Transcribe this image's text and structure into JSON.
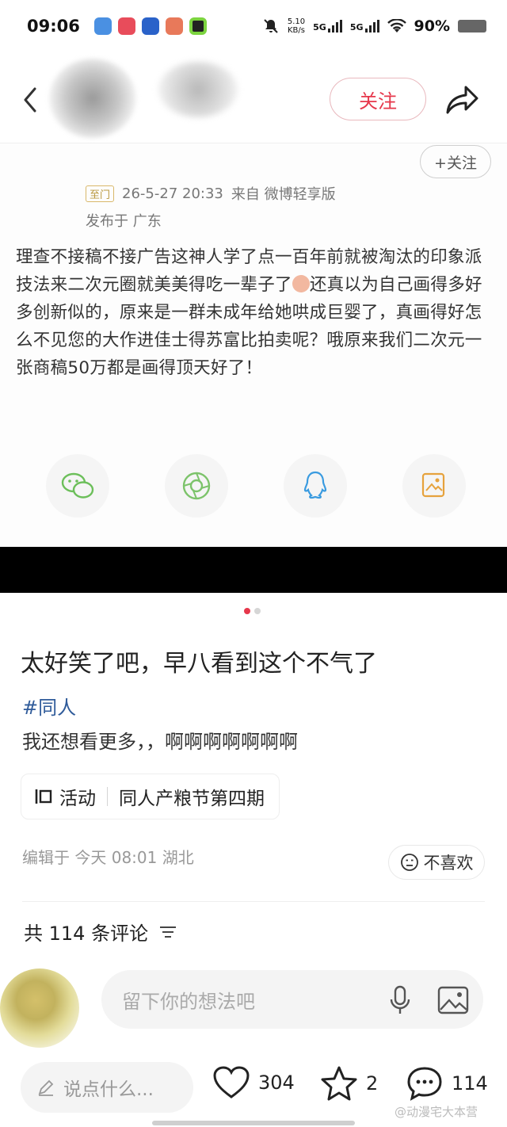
{
  "status_bar": {
    "time": "09:06",
    "speed_value": "5.10",
    "speed_unit": "KB/s",
    "network1": "5G",
    "network2": "5G",
    "battery": "90%",
    "app_icon_colors": [
      "#4a90e2",
      "#e84c5b",
      "#2a62c9",
      "#e8795a",
      "#222222"
    ]
  },
  "nav": {
    "follow_label": "关注"
  },
  "weibo_card": {
    "follow_small_label": "+关注",
    "vip_badge": "⾄门",
    "datetime": "26-5-27 20:33",
    "source": "来自 微博轻享版",
    "location": "发布于 广东",
    "text_part1": "理查不接稿不接广告这神人学了点一百年前就被淘汰的印象派技法来二次元圈就美美得吃一辈子了",
    "text_part2": "还真以为自己画得多好多创新似的，原来是一群未成年给她哄成巨婴了，真画得好怎么不见您的大作进佳士得苏富比拍卖呢？哦原来我们二次元一张商稿50万都是画得顶天好了！"
  },
  "post": {
    "title": "太好笑了吧，早八看到这个不气了",
    "hashtag": "#同人",
    "body": "我还想看更多，，啊啊啊啊啊啊啊",
    "activity_label": "活动",
    "activity_name": "同人产粮节第四期",
    "edit_meta": "编辑于 今天 08:01 湖北",
    "dislike_label": "不喜欢",
    "comment_count": "共 114 条评论"
  },
  "comment_input": {
    "placeholder": "留下你的想法吧"
  },
  "bottom_bar": {
    "say_placeholder": "说点什么...",
    "likes": "304",
    "stars": "2",
    "comments": "114"
  },
  "watermark": "@动漫宅大本营",
  "colors": {
    "accent_red": "#e6374b",
    "link_blue": "#2f5b9a"
  }
}
